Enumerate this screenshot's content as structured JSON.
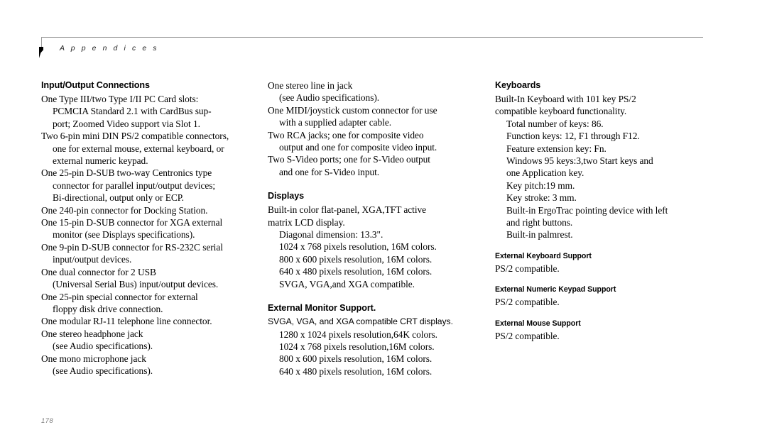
{
  "header": {
    "title": "A p p e n d i c e s",
    "marker_icon": "flag-marker-icon"
  },
  "footer": {
    "page_number": "178"
  },
  "columns": {
    "column_1": {
      "heading": "Input/Output Connections",
      "lines": [
        "One Type III/two Type I/II PC Card slots:",
        "PCMCIA Standard 2.1 with CardBus sup-",
        "port; Zoomed Video support via Slot 1.",
        "Two 6-pin mini DIN PS/2 compatible connectors,",
        "one for external mouse, external keyboard, or",
        "external numeric keypad.",
        "One 25-pin D-SUB two-way Centronics type",
        "connector for parallel input/output devices;",
        "Bi-directional, output only or ECP.",
        "One 240-pin connector for Docking Station.",
        "One 15-pin D-SUB connector for XGA external",
        "monitor (see Displays specifications).",
        "One 9-pin D-SUB connector for RS-232C serial",
        "input/output devices.",
        "One dual connector for 2 USB",
        "(Universal Serial Bus) input/output devices.",
        "One 25-pin special connector for external",
        "floppy disk drive connection.",
        "One modular RJ-11 telephone line connector.",
        "One stereo headphone jack",
        "(see Audio specifications).",
        "One mono microphone jack",
        "(see Audio specifications)."
      ]
    },
    "column_2": {
      "io_continued": [
        "One stereo line in jack",
        "(see Audio specifications).",
        "One MIDI/joystick custom connector for use",
        "with a supplied adapter cable.",
        "Two RCA jacks;  one for composite video",
        "output and one for composite video input.",
        "Two S-Video ports; one for S-Video output",
        "and one for S-Video input."
      ],
      "displays": {
        "heading": "Displays",
        "lines": [
          "Built-in color flat-panel, XGA,TFT  active",
          "matrix LCD display.",
          "Diagonal dimension: 13.3\".",
          "1024 x 768 pixels resolution, 16M colors.",
          "800 x 600 pixels resolution, 16M colors.",
          "640 x 480 pixels resolution, 16M colors.",
          "SVGA, VGA,and  XGA compatible."
        ]
      },
      "external_monitor": {
        "heading": "External Monitor Support.",
        "intro": "SVGA, VGA, and XGA compatible CRT displays.",
        "lines": [
          "1280 x 1024 pixels resolution,64K  colors.",
          "1024 x 768 pixels resolution,16M  colors.",
          "800 x 600 pixels resolution, 16M colors.",
          "640 x 480 pixels resolution, 16M colors."
        ]
      }
    },
    "column_3": {
      "keyboards": {
        "heading": "Keyboards",
        "intro_1": "Built-In Keyboard with 101 key PS/2",
        "intro_2": "compatible keyboard functionality.",
        "lines": [
          "Total number of keys: 86.",
          "Function keys: 12, F1 through F12.",
          "Feature extension key: Fn.",
          "Windows 95 keys:3,two Start keys and",
          "one Application key.",
          "Key pitch:19  mm.",
          "Key stroke: 3 mm.",
          "Built-in ErgoTrac pointing device with left",
          "and right buttons.",
          "Built-in palmrest."
        ]
      },
      "external_keyboard": {
        "heading": "External Keyboard Support",
        "body": "PS/2 compatible."
      },
      "external_numeric_keypad": {
        "heading": "External Numeric Keypad Support",
        "body": "PS/2 compatible."
      },
      "external_mouse": {
        "heading": "External Mouse Support",
        "body": "PS/2 compatible."
      }
    }
  }
}
